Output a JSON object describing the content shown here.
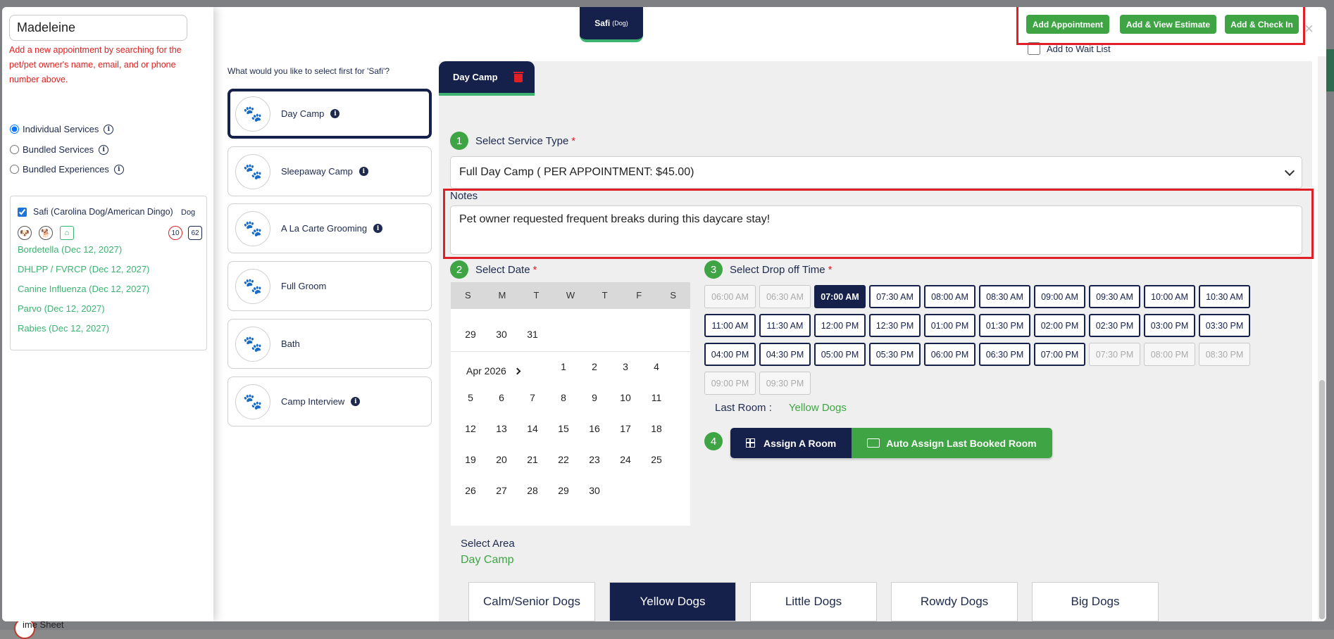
{
  "sidebar": {
    "search_value": "Madeleine",
    "hint": "Add a new appointment by searching for the pet/pet owner's name, email, and or phone number above.",
    "service_modes": [
      {
        "label": "Individual Services",
        "checked": true
      },
      {
        "label": "Bundled Services",
        "checked": false
      },
      {
        "label": "Bundled Experiences",
        "checked": false
      }
    ],
    "pet": {
      "name": "Safi (Carolina Dog/American Dingo)",
      "type": "Dog",
      "badge_age": "10",
      "badge_weight": "62",
      "vaccines": [
        "Bordetella (Dec 12, 2027)",
        "DHLPP / FVRCP (Dec 12, 2027)",
        "Canine Influenza (Dec 12, 2027)",
        "Parvo (Dec 12, 2027)",
        "Rabies (Dec 12, 2027)"
      ]
    }
  },
  "services": {
    "prompt": "What would you like to select first for 'Safi'?",
    "items": [
      {
        "label": "Day Camp",
        "info": true
      },
      {
        "label": "Sleepaway Camp",
        "info": true
      },
      {
        "label": "A La Carte Grooming",
        "info": true
      },
      {
        "label": "Full Groom",
        "info": false
      },
      {
        "label": "Bath",
        "info": false
      },
      {
        "label": "Camp Interview",
        "info": true
      }
    ]
  },
  "header": {
    "pet_tab": "Safi",
    "pet_tab_type": "(Dog)",
    "add_appointment": "Add Appointment",
    "add_view_estimate": "Add & View Estimate",
    "add_check_in": "Add & Check In",
    "wait_list": "Add to Wait List",
    "close": "×"
  },
  "main": {
    "service_tab": "Day Camp",
    "step1": {
      "num": "1",
      "label": "Select Service Type"
    },
    "service_type": "Full Day Camp ( PER APPOINTMENT: $45.00)",
    "notes_label": "Notes",
    "notes_value": "Pet owner requested frequent breaks during this daycare stay!",
    "step2": {
      "num": "2",
      "label": "Select Date"
    },
    "step3": {
      "num": "3",
      "label": "Select Drop off Time"
    },
    "step4": {
      "num": "4"
    },
    "calendar": {
      "weekdays": [
        "S",
        "M",
        "T",
        "W",
        "T",
        "F",
        "S"
      ],
      "prev_row": [
        "29",
        "30",
        "31"
      ],
      "month": "Apr 2026",
      "first_row": [
        "1",
        "2",
        "3",
        "4"
      ],
      "weeks": [
        [
          "5",
          "6",
          "7",
          "8",
          "9",
          "10",
          "11"
        ],
        [
          "12",
          "13",
          "14",
          "15",
          "16",
          "17",
          "18"
        ],
        [
          "19",
          "20",
          "21",
          "22",
          "23",
          "24",
          "25"
        ],
        [
          "26",
          "27",
          "28",
          "29",
          "30"
        ]
      ]
    },
    "times": [
      {
        "t": "06:00 AM",
        "s": "disabled"
      },
      {
        "t": "06:30 AM",
        "s": "disabled"
      },
      {
        "t": "07:00 AM",
        "s": "selected"
      },
      {
        "t": "07:30 AM",
        "s": ""
      },
      {
        "t": "08:00 AM",
        "s": ""
      },
      {
        "t": "08:30 AM",
        "s": ""
      },
      {
        "t": "09:00 AM",
        "s": ""
      },
      {
        "t": "09:30 AM",
        "s": ""
      },
      {
        "t": "10:00 AM",
        "s": ""
      },
      {
        "t": "10:30 AM",
        "s": ""
      },
      {
        "t": "11:00 AM",
        "s": ""
      },
      {
        "t": "11:30 AM",
        "s": ""
      },
      {
        "t": "12:00 PM",
        "s": ""
      },
      {
        "t": "12:30 PM",
        "s": ""
      },
      {
        "t": "01:00 PM",
        "s": ""
      },
      {
        "t": "01:30 PM",
        "s": ""
      },
      {
        "t": "02:00 PM",
        "s": ""
      },
      {
        "t": "02:30 PM",
        "s": ""
      },
      {
        "t": "03:00 PM",
        "s": ""
      },
      {
        "t": "03:30 PM",
        "s": ""
      },
      {
        "t": "04:00 PM",
        "s": ""
      },
      {
        "t": "04:30 PM",
        "s": ""
      },
      {
        "t": "05:00 PM",
        "s": ""
      },
      {
        "t": "05:30 PM",
        "s": ""
      },
      {
        "t": "06:00 PM",
        "s": ""
      },
      {
        "t": "06:30 PM",
        "s": ""
      },
      {
        "t": "07:00 PM",
        "s": ""
      },
      {
        "t": "07:30 PM",
        "s": "disabled"
      },
      {
        "t": "08:00 PM",
        "s": "disabled"
      },
      {
        "t": "08:30 PM",
        "s": "disabled"
      },
      {
        "t": "09:00 PM",
        "s": "disabled"
      },
      {
        "t": "09:30 PM",
        "s": "disabled"
      }
    ],
    "last_room_label": "Last Room :",
    "last_room_value": "Yellow Dogs",
    "assign_room": "Assign A Room",
    "auto_assign": "Auto Assign Last Booked Room",
    "area_label": "Select Area",
    "area_value": "Day Camp",
    "rooms": [
      {
        "label": "Calm/Senior Dogs",
        "active": false
      },
      {
        "label": "Yellow Dogs",
        "active": true
      },
      {
        "label": "Little Dogs",
        "active": false
      },
      {
        "label": "Rowdy Dogs",
        "active": false
      },
      {
        "label": "Big Dogs",
        "active": false
      }
    ]
  },
  "background": {
    "time_sheet": "ime Sheet"
  },
  "colors": {
    "navy": "#15204b",
    "green": "#3ea444",
    "red": "#e01f26"
  }
}
